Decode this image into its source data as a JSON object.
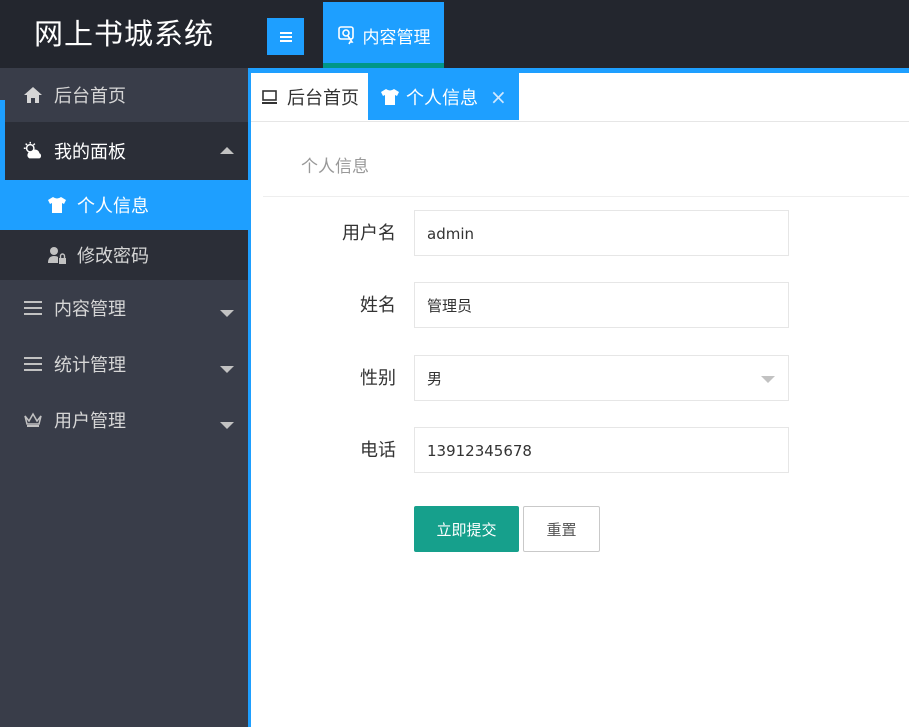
{
  "app": {
    "title": "网上书城系统"
  },
  "topnav": {
    "menu_icon": "menu-icon",
    "content_mgmt_label": "内容管理",
    "content_mgmt_icon": "document-stamp-icon"
  },
  "sidebar": {
    "items": [
      {
        "label": "后台首页",
        "icon": "home-icon"
      },
      {
        "label": "我的面板",
        "icon": "weather-icon",
        "expanded": true,
        "children": [
          {
            "label": "个人信息",
            "icon": "shirt-icon",
            "active": true
          },
          {
            "label": "修改密码",
            "icon": "user-lock-icon"
          }
        ]
      },
      {
        "label": "内容管理",
        "icon": "list-icon"
      },
      {
        "label": "统计管理",
        "icon": "list-icon"
      },
      {
        "label": "用户管理",
        "icon": "crown-icon"
      }
    ]
  },
  "tabs": [
    {
      "label": "后台首页",
      "icon": "monitor-icon"
    },
    {
      "label": "个人信息",
      "icon": "shirt-icon",
      "active": true,
      "close": "×"
    }
  ],
  "panel": {
    "title": "个人信息"
  },
  "form": {
    "username": {
      "label": "用户名",
      "value": "admin"
    },
    "name": {
      "label": "姓名",
      "value": "管理员"
    },
    "gender": {
      "label": "性别",
      "value": "男"
    },
    "phone": {
      "label": "电话",
      "value": "13912345678"
    },
    "submit_label": "立即提交",
    "reset_label": "重置"
  },
  "colors": {
    "accent": "#1e9fff",
    "header_bg": "#23262e",
    "sidebar_bg": "#393d49",
    "submit": "#16a08c"
  }
}
